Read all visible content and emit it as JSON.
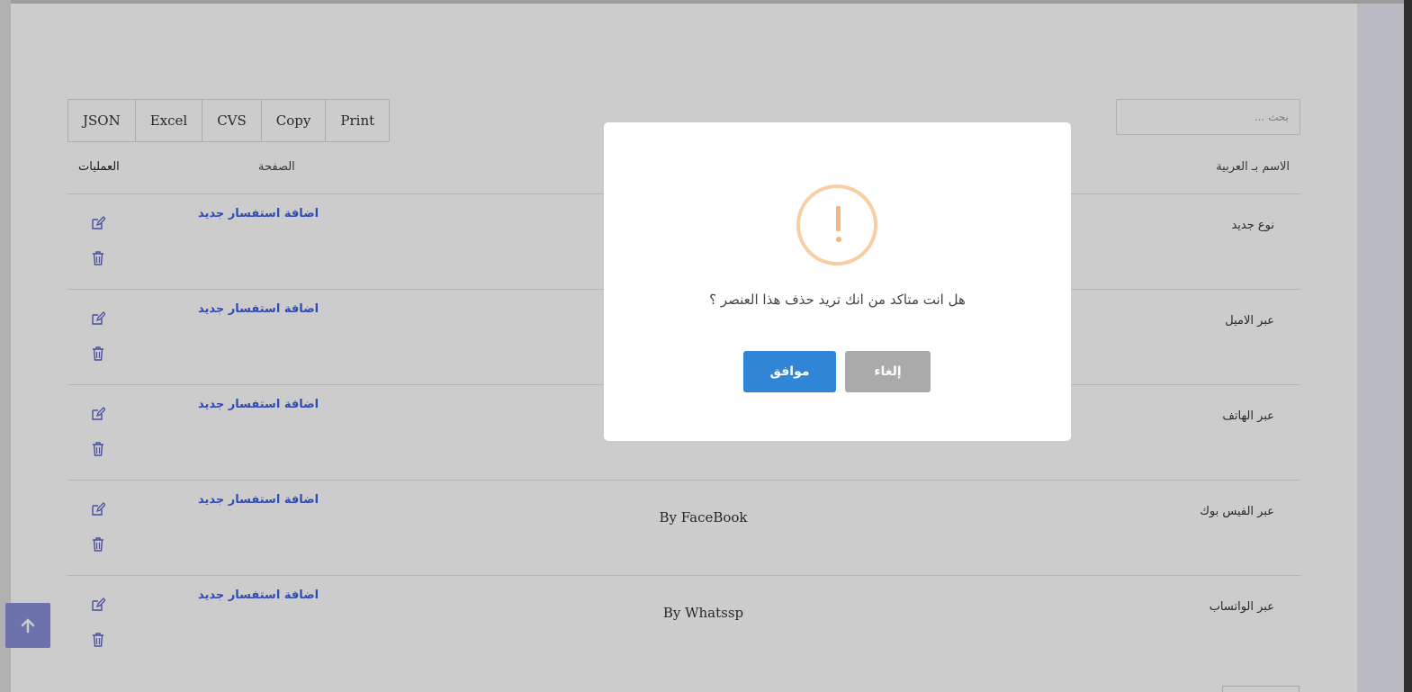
{
  "toolbar": {
    "export_buttons": [
      "JSON",
      "Excel",
      "CVS",
      "Copy",
      "Print"
    ]
  },
  "search": {
    "placeholder": "بحث ..."
  },
  "table": {
    "headers": {
      "operations": "العمليات",
      "page": "الصفحة",
      "name_ar": "الاسم بـ العربية"
    },
    "rows": [
      {
        "link": "اضافة استفسار جديد",
        "name_en": "",
        "name_ar": "نوع جديد"
      },
      {
        "link": "اضافة استفسار جديد",
        "name_en": "",
        "name_ar": "عبر الاميل"
      },
      {
        "link": "اضافة استفسار جديد",
        "name_en": "",
        "name_ar": "عبر الهاتف"
      },
      {
        "link": "اضافة استفسار جديد",
        "name_en": "By FaceBook",
        "name_ar": "عبر الفيس بوك"
      },
      {
        "link": "اضافة استفسار جديد",
        "name_en": "By Whatssp",
        "name_ar": "عبر الواتساب"
      }
    ]
  },
  "icons": {
    "edit": "edit-icon",
    "delete": "trash-icon",
    "scroll_top": "arrow-up-icon",
    "warning": "exclamation-icon"
  },
  "dialog": {
    "message": "هل انت متاكد من انك تريد حذف هذا العنصر ؟",
    "confirm_label": "موافق",
    "cancel_label": "إلغاء"
  },
  "colors": {
    "link": "#3c5fe0",
    "confirm": "#3085d6",
    "cancel": "#aaaaaa",
    "warning": "#f8bb86",
    "scroll_button": "#8a8fd8"
  }
}
